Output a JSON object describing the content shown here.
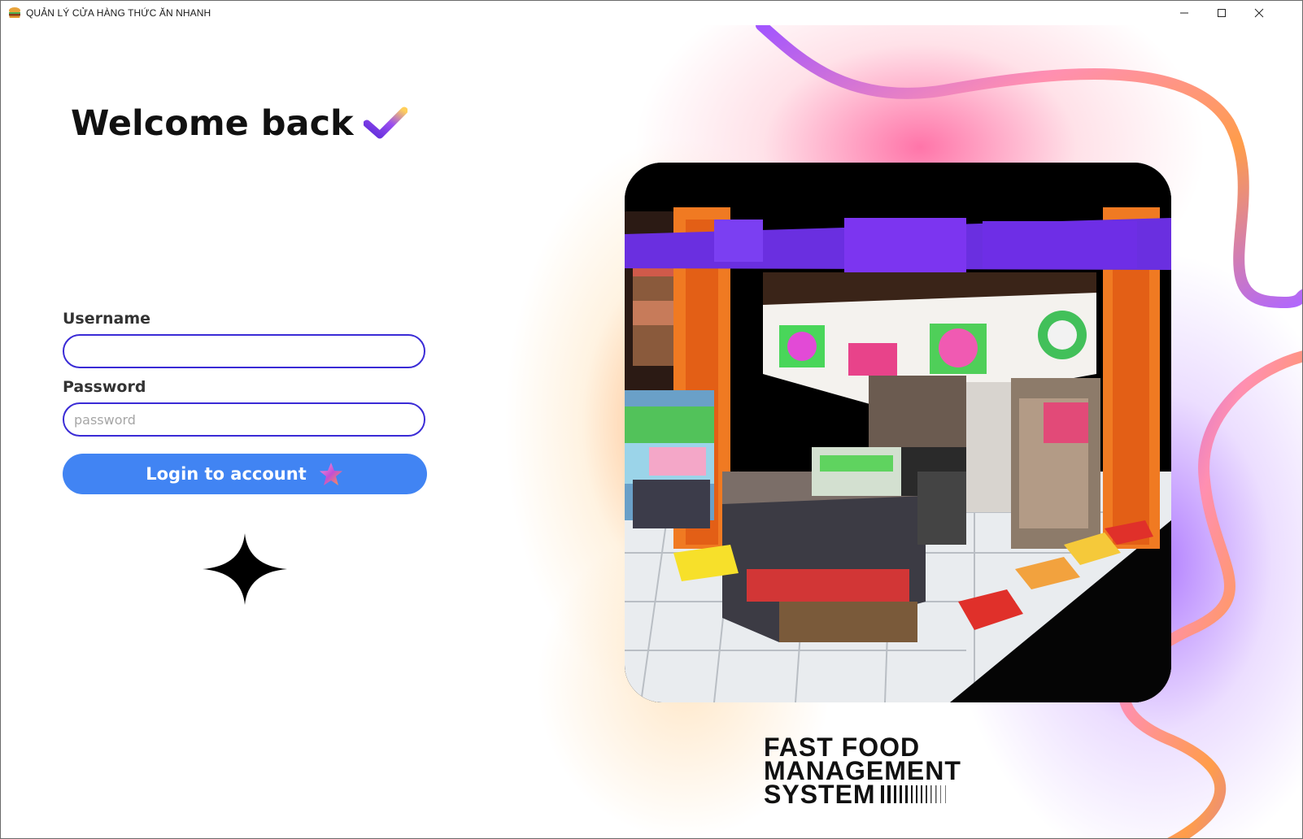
{
  "window": {
    "title": "QUẢN LÝ CỬA HÀNG THỨC ĂN NHANH",
    "controls": [
      "minimize-icon",
      "maximize-icon",
      "close-icon"
    ]
  },
  "login": {
    "welcome": "Welcome back",
    "username_label": "Username",
    "username_value": "",
    "password_label": "Password",
    "password_placeholder": "password",
    "login_button": "Login to account"
  },
  "brand": {
    "line1": "FAST FOOD",
    "line2": "MANAGEMENT",
    "line3": "SYSTEM"
  },
  "colors": {
    "accent_blue": "#4184f3",
    "input_border": "#3a2bd6",
    "purple": "#8f4cf5",
    "orange": "#ff7a1a",
    "pink": "#ff5d98"
  },
  "icons": {
    "app": "burger-icon",
    "welcome": "check-icon",
    "button": "star-icon",
    "decoration": "sparkle-icon"
  }
}
